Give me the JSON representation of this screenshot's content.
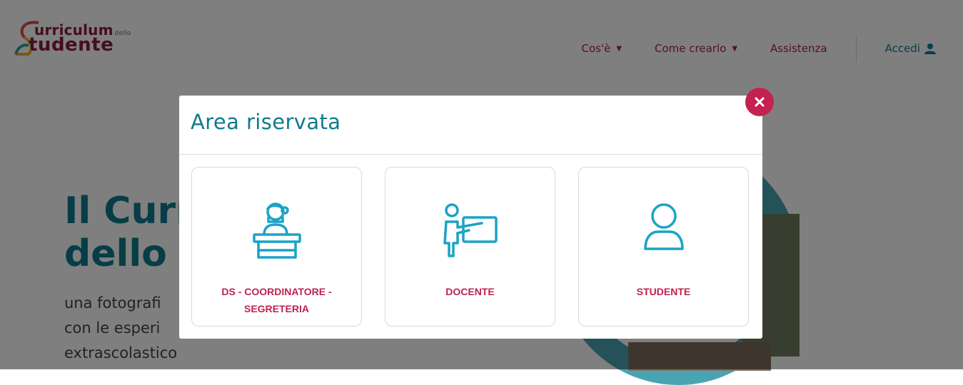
{
  "header": {
    "logo": {
      "line1": "urriculum",
      "small": "dello",
      "line2": "tudente"
    },
    "nav": [
      {
        "label": "Cos'è",
        "has_caret": true
      },
      {
        "label": "Come crearlo",
        "has_caret": true
      },
      {
        "label": "Assistenza",
        "has_caret": false
      }
    ],
    "login_label": "Accedi"
  },
  "hero": {
    "title_line1": "Il Curr",
    "title_line2": "dello s",
    "sub_line1": "una fotografi",
    "sub_line2": "con le esperi",
    "sub_line3": "extrascolastico"
  },
  "modal": {
    "title": "Area riservata",
    "close_icon": "times-icon",
    "cards": [
      {
        "label_line1": "DS - COORDINATORE -",
        "label_line2": "SEGRETERIA",
        "icon": "receptionist-icon"
      },
      {
        "label_line1": "DOCENTE",
        "label_line2": "",
        "icon": "teacher-board-icon"
      },
      {
        "label_line1": "STUDENTE",
        "label_line2": "",
        "icon": "user-icon"
      }
    ]
  },
  "colors": {
    "accent_teal": "#0f7b8c",
    "accent_red": "#c0224f",
    "icon_blue": "#1ba3c6",
    "overlay": "rgba(0,0,0,0.5)"
  }
}
